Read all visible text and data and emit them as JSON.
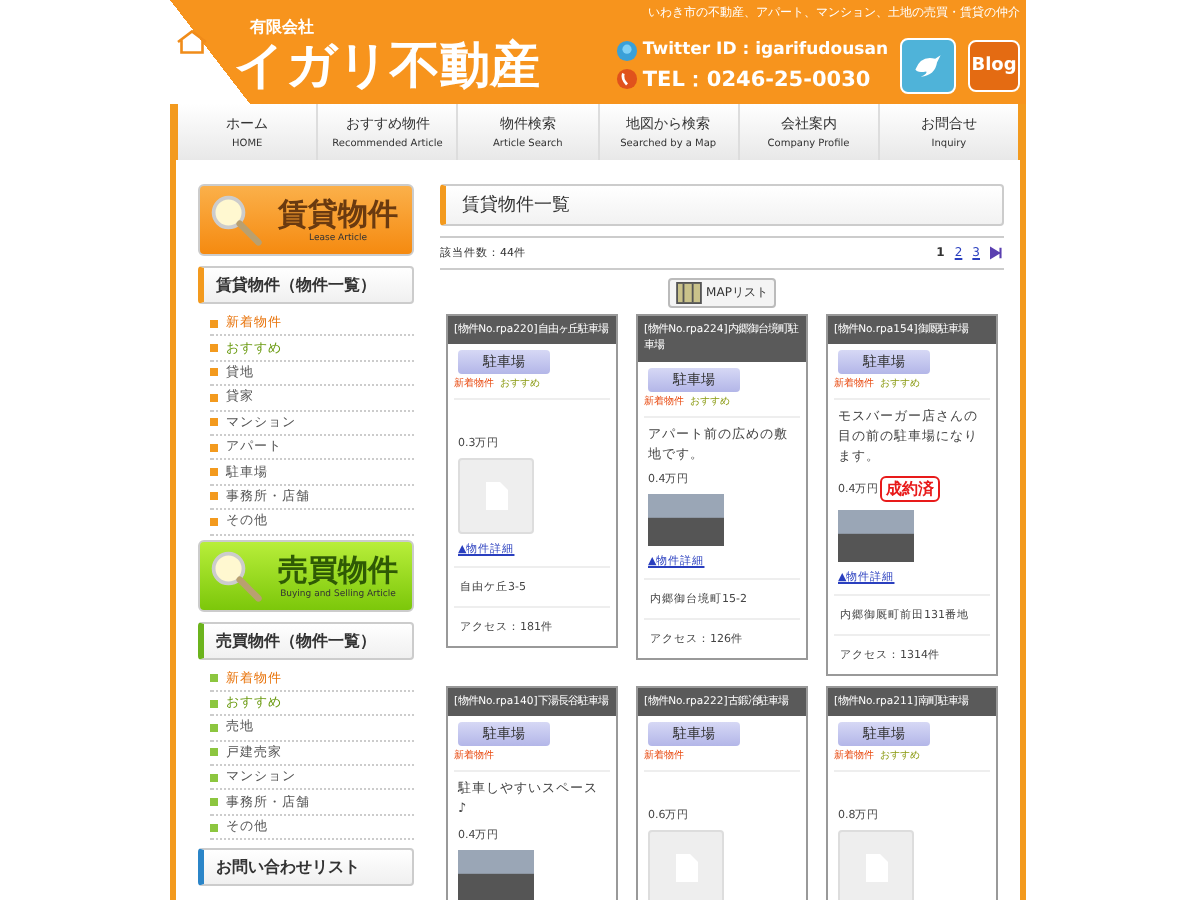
{
  "header": {
    "tagline": "いわき市の不動産、アパート、マンション、土地の売買・賃貸の仲介",
    "company_type": "有限会社",
    "company_name": "イガリ不動産",
    "twitter": "Twitter ID : igarifudousan",
    "tel": "TEL：0246-25-0030",
    "blog_button": "Blog"
  },
  "nav": [
    {
      "label": "ホーム",
      "sub": "HOME"
    },
    {
      "label": "おすすめ物件",
      "sub": "Recommended Article"
    },
    {
      "label": "物件検索",
      "sub": "Article Search"
    },
    {
      "label": "地図から検索",
      "sub": "Searched by a Map"
    },
    {
      "label": "会社案内",
      "sub": "Company Profile"
    },
    {
      "label": "お問合せ",
      "sub": "Inquiry"
    }
  ],
  "sidebar": {
    "sections": [
      {
        "kind": "lease",
        "banner": "賃貸物件",
        "banner_sub": "Lease Article",
        "heading": "賃貸物件（物件一覧）",
        "items": [
          {
            "label": "新着物件",
            "kind": "new"
          },
          {
            "label": "おすすめ",
            "kind": "recommend"
          },
          {
            "label": "貸地",
            "kind": "normal"
          },
          {
            "label": "貸家",
            "kind": "normal"
          },
          {
            "label": "マンション",
            "kind": "normal"
          },
          {
            "label": "アパート",
            "kind": "normal"
          },
          {
            "label": "駐車場",
            "kind": "normal"
          },
          {
            "label": "事務所・店舗",
            "kind": "normal"
          },
          {
            "label": "その他",
            "kind": "normal"
          }
        ]
      },
      {
        "kind": "sale",
        "banner": "売買物件",
        "banner_sub": "Buying and Selling Article",
        "heading": "売買物件（物件一覧）",
        "items": [
          {
            "label": "新着物件",
            "kind": "new"
          },
          {
            "label": "おすすめ",
            "kind": "recommend"
          },
          {
            "label": "売地",
            "kind": "normal"
          },
          {
            "label": "戸建売家",
            "kind": "normal"
          },
          {
            "label": "マンション",
            "kind": "normal"
          },
          {
            "label": "事務所・店舗",
            "kind": "normal"
          },
          {
            "label": "その他",
            "kind": "normal"
          }
        ]
      }
    ],
    "contact_heading": "お問い合わせリスト"
  },
  "main": {
    "heading": "賃貸物件一覧",
    "count": "該当件数：44件",
    "pages": [
      {
        "label": "1",
        "selected": true
      },
      {
        "label": "2",
        "selected": false
      },
      {
        "label": "3",
        "selected": false
      }
    ],
    "map_button": "MAPリスト",
    "listings": [
      {
        "title": "[物件No.rpa220]自由ヶ丘駐車場",
        "category": "駐車場",
        "new_label": "新着物件",
        "recommend_label": "おすすめ",
        "price": "0.3万円",
        "has_photo": false,
        "link": "▲物件詳細",
        "address": "自由ケ丘3-5",
        "access": "アクセス：181件"
      },
      {
        "title": "[物件No.rpa224]内郷御台境町駐車場",
        "category": "駐車場",
        "new_label": "新着物件",
        "recommend_label": "おすすめ",
        "description": "アパート前の広めの敷地です。",
        "price": "0.4万円",
        "has_photo": true,
        "link": "▲物件詳細",
        "address": "内郷御台境町15-2",
        "access": "アクセス：126件"
      },
      {
        "title": "[物件No.rpa154]御厩駐車場",
        "category": "駐車場",
        "new_label": "新着物件",
        "recommend_label": "おすすめ",
        "description": "モスバーガー店さんの目の前の駐車場になります。",
        "price": "0.4万円",
        "sold": "成約済",
        "has_photo": true,
        "link": "▲物件詳細",
        "address": "内郷御厩町前田131番地",
        "access": "アクセス：1314件"
      },
      {
        "title": "[物件No.rpa140]下湯長谷駐車場",
        "category": "駐車場",
        "new_label": "新着物件",
        "description": "駐車しやすいスペース♪",
        "price": "0.4万円",
        "has_photo": true
      },
      {
        "title": "[物件No.rpa222]古鍛冶駐車場",
        "category": "駐車場",
        "new_label": "新着物件",
        "price": "0.6万円",
        "has_photo": false
      },
      {
        "title": "[物件No.rpa211]南町駐車場",
        "category": "駐車場",
        "new_label": "新着物件",
        "recommend_label": "おすすめ",
        "price": "0.8万円",
        "has_photo": false
      }
    ]
  }
}
